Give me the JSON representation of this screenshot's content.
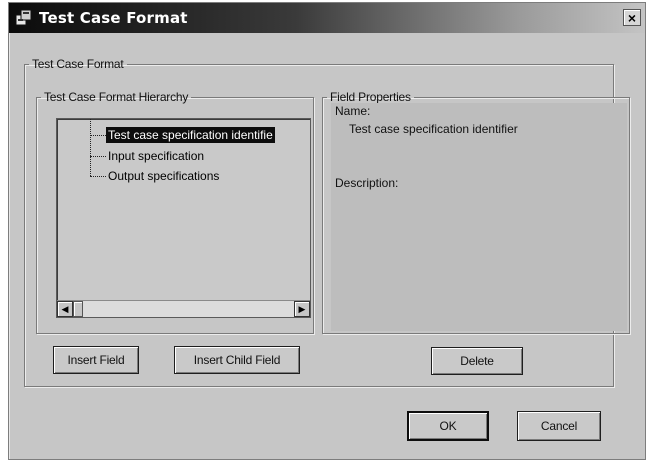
{
  "window": {
    "title": "Test Case Format",
    "close_label": "×"
  },
  "outer_group": {
    "label": "Test Case Format"
  },
  "hierarchy_group": {
    "label": "Test Case Format Hierarchy",
    "items": [
      {
        "label": "Test case specification identifie",
        "selected": true
      },
      {
        "label": "Input specification",
        "selected": false
      },
      {
        "label": "Output specifications",
        "selected": false
      }
    ],
    "scroll_left": "◀",
    "scroll_right": "▶"
  },
  "properties_group": {
    "label": "Field Properties",
    "name_label": "Name:",
    "name_value": "Test case specification identifier",
    "description_label": "Description:"
  },
  "buttons": {
    "insert_field": "Insert Field",
    "insert_child_field": "Insert Child Field",
    "delete": "Delete",
    "ok": "OK",
    "cancel": "Cancel"
  },
  "icons": {
    "app": "dialog-app-icon",
    "close": "close-icon"
  }
}
